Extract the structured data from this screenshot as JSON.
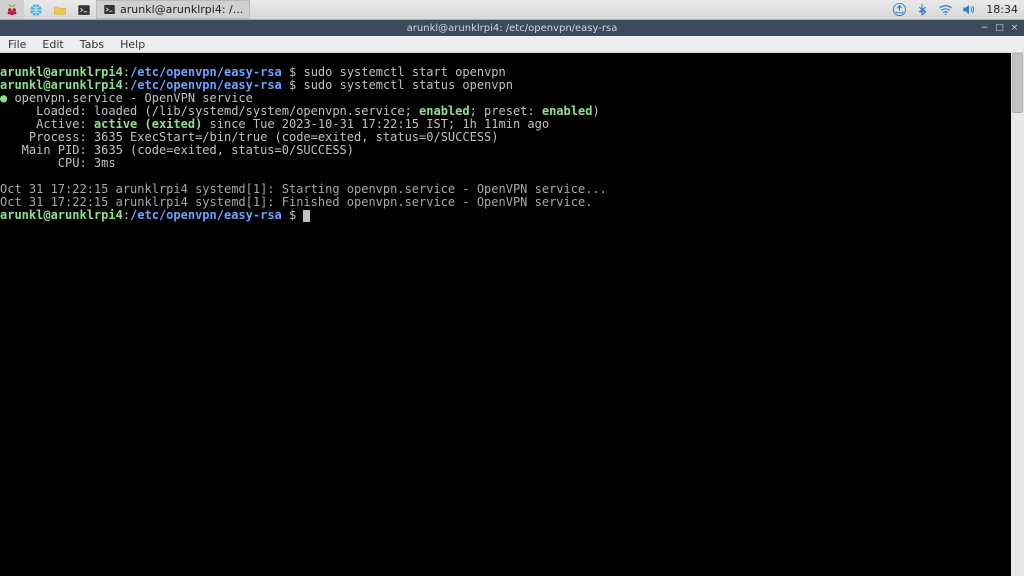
{
  "panel": {
    "taskbar_label": "arunkl@arunklrpi4: /...",
    "clock": "18:34"
  },
  "window": {
    "title": "arunkl@arunklrpi4: /etc/openvpn/easy-rsa"
  },
  "menubar": [
    "File",
    "Edit",
    "Tabs",
    "Help"
  ],
  "prompt": {
    "user": "arunkl@arunklrpi4",
    "path": "/etc/openvpn/easy-rsa",
    "sep": ":",
    "dollar": " $ "
  },
  "cmds": {
    "start": "sudo systemctl start openvpn",
    "status": "sudo systemctl status openvpn"
  },
  "status": {
    "bullet": "●",
    "svc_line": " openvpn.service - OpenVPN service",
    "loaded_lbl": "     Loaded: ",
    "loaded_a": "loaded (/lib/systemd/system/openvpn.service; ",
    "loaded_enabled": "enabled",
    "loaded_b": "; preset: ",
    "loaded_preset": "enabled",
    "loaded_c": ")",
    "active_lbl": "     Active: ",
    "active_val": "active (exited)",
    "active_rest": " since Tue 2023-10-31 17:22:15 IST; 1h 11min ago",
    "process": "    Process: 3635 ExecStart=/bin/true (code=exited, status=0/SUCCESS)",
    "mainpid": "   Main PID: 3635 (code=exited, status=0/SUCCESS)",
    "cpu": "        CPU: 3ms"
  },
  "log1": "Oct 31 17:22:15 arunklrpi4 systemd[1]: Starting openvpn.service - OpenVPN service...",
  "log2": "Oct 31 17:22:15 arunklrpi4 systemd[1]: Finished openvpn.service - OpenVPN service."
}
